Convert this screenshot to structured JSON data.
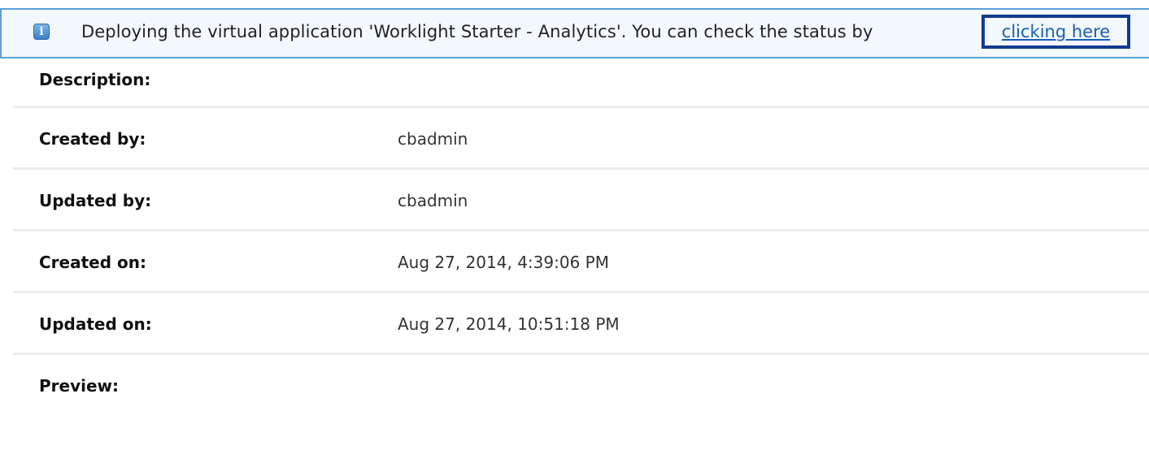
{
  "notification": {
    "icon": "info-icon",
    "icon_glyph": "i",
    "message": "Deploying the virtual application 'Worklight Starter - Analytics'. You can check the status by",
    "link_label": "clicking here"
  },
  "properties": [
    {
      "label": "Description:",
      "value": ""
    },
    {
      "label": "Created by:",
      "value": "cbadmin"
    },
    {
      "label": "Updated by:",
      "value": "cbadmin"
    },
    {
      "label": "Created on:",
      "value": "Aug 27, 2014, 4:39:06 PM"
    },
    {
      "label": "Updated on:",
      "value": "Aug 27, 2014, 10:51:18 PM"
    },
    {
      "label": "Preview:",
      "value": ""
    }
  ],
  "colors": {
    "info_border": "#5d9fd8",
    "info_background": "#f2f8fd",
    "link": "#1a5fb4",
    "highlight_border": "#123a8f"
  }
}
